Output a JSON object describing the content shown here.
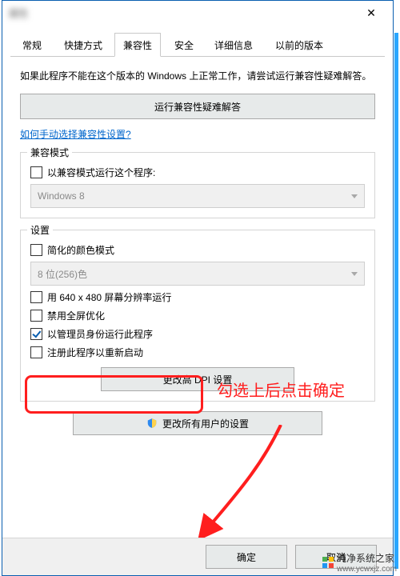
{
  "window": {
    "title": "属性",
    "close": "✕"
  },
  "tabs": {
    "general": "常规",
    "shortcut": "快捷方式",
    "compat": "兼容性",
    "security": "安全",
    "details": "详细信息",
    "prev": "以前的版本"
  },
  "intro": "如果此程序不能在这个版本的 Windows 上正常工作，请尝试运行兼容性疑难解答。",
  "buttons": {
    "troubleshoot": "运行兼容性疑难解答",
    "dpi": "更改高 DPI 设置",
    "allusers": "更改所有用户的设置",
    "ok": "确定",
    "cancel": "取消"
  },
  "link": "如何手动选择兼容性设置?",
  "group_compat": {
    "legend": "兼容模式",
    "chk": "以兼容模式运行这个程序:",
    "select": "Windows 8"
  },
  "group_settings": {
    "legend": "设置",
    "reduced_color": "简化的颜色模式",
    "color_select": "8 位(256)色",
    "res640": "用 640 x 480 屏幕分辨率运行",
    "disable_fullscreen": "禁用全屏优化",
    "run_as_admin": "以管理员身份运行此程序",
    "register_restart": "注册此程序以重新启动"
  },
  "annotation": "勾选上后点击确定",
  "watermark": {
    "name": "纯净系统之家",
    "url": "www.ycwxjz.com"
  }
}
